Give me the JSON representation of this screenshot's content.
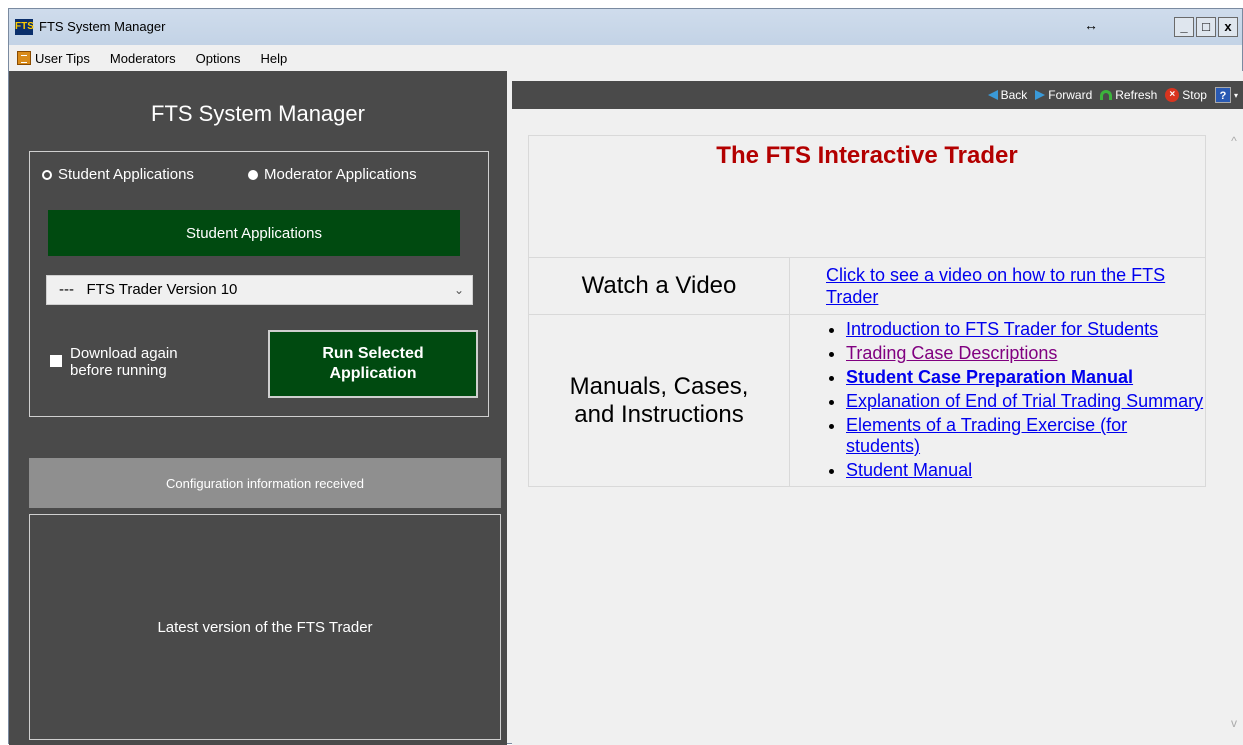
{
  "window": {
    "title": "FTS System Manager",
    "app_icon_text": "FTS",
    "resize_glyph": "↔",
    "minimize": "_",
    "maximize": "□",
    "close": "x"
  },
  "menu": {
    "items": [
      "User Tips",
      "Moderators",
      "Options",
      "Help"
    ]
  },
  "left_panel": {
    "title": "FTS System Manager",
    "radio_student": "Student Applications",
    "radio_moderator": "Moderator Applications",
    "selected_radio": "Moderator Applications",
    "apps_button": "Student Applications",
    "select_value": "---   FTS Trader Version 10",
    "checkbox_label_line1": "Download again",
    "checkbox_label_line2": "before running",
    "run_button_line1": "Run Selected",
    "run_button_line2": "Application",
    "status": "Configuration information received",
    "info": "Latest version of the FTS Trader"
  },
  "browser": {
    "toolbar": {
      "back": "Back",
      "forward": "Forward",
      "refresh": "Refresh",
      "stop": "Stop"
    },
    "heading": "The FTS Interactive Trader",
    "video_label": "Watch a Video",
    "video_link": "Click to see a video on how to run the FTS Trader",
    "manuals_label_line1": "Manuals, Cases,",
    "manuals_label_line2": "and Instructions",
    "links": [
      "Introduction to FTS Trader for Students",
      "Trading Case Descriptions",
      "Student Case Preparation Manual",
      "Explanation of End of Trial Trading Summary",
      "Elements of a Trading Exercise (for students)",
      "Student Manual"
    ]
  },
  "colors": {
    "panel_dark": "#4a4a4a",
    "button_green": "#004a10",
    "heading_red": "#b30000",
    "link_blue": "#0000ee",
    "link_visited": "#800080"
  }
}
